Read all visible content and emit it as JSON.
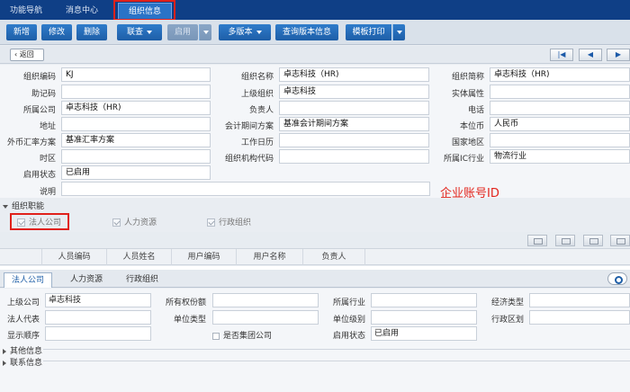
{
  "top_tabs": [
    "功能导航",
    "消息中心",
    "组织信息"
  ],
  "toolbar": {
    "add": "新增",
    "edit": "修改",
    "delete": "删除",
    "link": "联查",
    "enable": "启用",
    "multi_version": "多版本",
    "query_version": "查询版本信息",
    "template_print": "模板打印"
  },
  "nav": {
    "back": "返回",
    "first_icon": "first-page-icon",
    "prev_icon": "prev-page-icon",
    "next_icon": "next-page-icon"
  },
  "form": {
    "org_code_label": "组织编码",
    "org_code": "KJ",
    "org_name_label": "组织名称",
    "org_name": "卓志科技（HR)",
    "org_short_label": "组织简称",
    "org_short": "卓志科技（HR)",
    "mnemonic_label": "助记码",
    "mnemonic": "",
    "parent_org_label": "上级组织",
    "parent_org": "卓志科技",
    "entity_attr_label": "实体属性",
    "entity_attr": "",
    "company_label": "所属公司",
    "company": "卓志科技（HR)",
    "owner_label": "负责人",
    "owner": "",
    "phone_label": "电话",
    "phone": "",
    "address_label": "地址",
    "address": "",
    "account_period_label": "会计期间方案",
    "account_period": "基准会计期间方案",
    "currency_label": "本位币",
    "currency": "人民币",
    "fx_label": "外币汇率方案",
    "fx": "基准汇率方案",
    "calendar_label": "工作日历",
    "calendar": "",
    "region_label": "国家地区",
    "region": "",
    "timezone_label": "时区",
    "timezone": "",
    "org_code_no_label": "组织机构代码",
    "org_code_no": "",
    "industry_label": "所属IC行业",
    "industry": "物流行业",
    "status_label": "启用状态",
    "status": "已启用",
    "desc_label": "说明",
    "desc": ""
  },
  "annotation": "企业账号ID",
  "functions": {
    "header": "组织职能",
    "items": [
      "法人公司",
      "人力资源",
      "行政组织"
    ]
  },
  "grid": {
    "columns": [
      "人员编码",
      "人员姓名",
      "用户编码",
      "用户名称",
      "负责人"
    ]
  },
  "sub_tabs": [
    "法人公司",
    "人力资源",
    "行政组织"
  ],
  "subform": {
    "parent_company_label": "上级公司",
    "parent_company": "卓志科技",
    "ownership_label": "所有权份额",
    "ownership": "",
    "industry_label": "所属行业",
    "industry": "",
    "econ_type_label": "经济类型",
    "econ_type": "",
    "legal_rep_label": "法人代表",
    "legal_rep": "",
    "unit_type_label": "单位类型",
    "unit_type": "",
    "unit_level_label": "单位级别",
    "unit_level": "",
    "admin_region_label": "行政区划",
    "admin_region": "",
    "display_order_label": "显示顺序",
    "display_order": "",
    "is_group_label": "是否集团公司",
    "status_label": "启用状态",
    "status": "已启用"
  },
  "collapsed_sections": [
    "其他信息",
    "联系信息"
  ]
}
